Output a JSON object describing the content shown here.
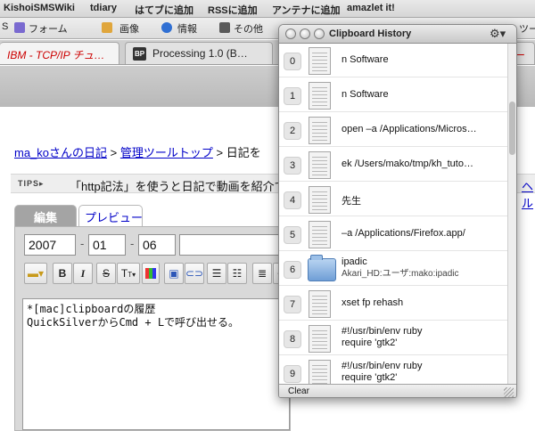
{
  "bookmarks": [
    "KishoiSMSWiki",
    "tdiary",
    "はてブに追加",
    "RSSに追加",
    "アンテナに追加",
    "amazlet it!"
  ],
  "toolbar2": {
    "items": [
      "S",
      "フォーム",
      "画像",
      "情報",
      "その他"
    ],
    "right_fragment": "ツー"
  },
  "tabs": [
    {
      "title": "IBM - TCP/IP チュ…",
      "favicon": "none",
      "color": "#cc0000"
    },
    {
      "title": "Processing 1.0 (B…",
      "favicon": "BP"
    },
    {
      "title": "マー",
      "favicon": "none",
      "color": "#cc0000"
    }
  ],
  "breadcrumb": {
    "link1": "ma_koさんの日記",
    "sep1": ">",
    "link2": "管理ツールトップ",
    "sep2": ">",
    "current": "日記を"
  },
  "tips": {
    "label": "TIPS▸",
    "message": "「http記法」を使うと日記で動画を紹介で",
    "more": "ヘル"
  },
  "editor": {
    "tab_edit": "編集",
    "tab_preview": "プレビュー",
    "year": "2007",
    "month": "01",
    "day": "06",
    "date_sep": "-",
    "format_buttons": [
      "folder",
      "B",
      "I",
      "S",
      "T",
      "color",
      "blog",
      "link",
      "ul",
      "ol",
      "indent"
    ],
    "body_line1": "*[mac]clipboardの履歴",
    "body_line2": "QuickSilverからCmd + Lで呼び出せる。"
  },
  "clipboard_history": {
    "title": "Clipboard History",
    "clear_label": "Clear",
    "scroll_position": 0.2,
    "items": [
      {
        "index": "0",
        "icon": "document-icon",
        "line1": "n Software",
        "line2": ""
      },
      {
        "index": "1",
        "icon": "document-icon",
        "line1": "n Software",
        "line2": ""
      },
      {
        "index": "2",
        "icon": "document-icon",
        "line1": "open –a /Applications/Micros…",
        "line2": ""
      },
      {
        "index": "3",
        "icon": "document-icon",
        "line1": "ek /Users/mako/tmp/kh_tuto…",
        "line2": ""
      },
      {
        "index": "4",
        "icon": "document-icon",
        "line1": "先生",
        "line2": ""
      },
      {
        "index": "5",
        "icon": "document-icon",
        "line1": "–a /Applications/Firefox.app/",
        "line2": ""
      },
      {
        "index": "6",
        "icon": "folder-icon",
        "line1": "ipadic",
        "line2": "Akari_HD:ユーザ:mako:ipadic"
      },
      {
        "index": "7",
        "icon": "document-icon",
        "line1": "xset fp rehash",
        "line2": ""
      },
      {
        "index": "8",
        "icon": "document-icon",
        "line1": "#!/usr/bin/env ruby",
        "line2": "require 'gtk2'"
      },
      {
        "index": "9",
        "icon": "document-icon",
        "line1": "#!/usr/bin/env ruby",
        "line2": "require 'gtk2'"
      }
    ]
  }
}
